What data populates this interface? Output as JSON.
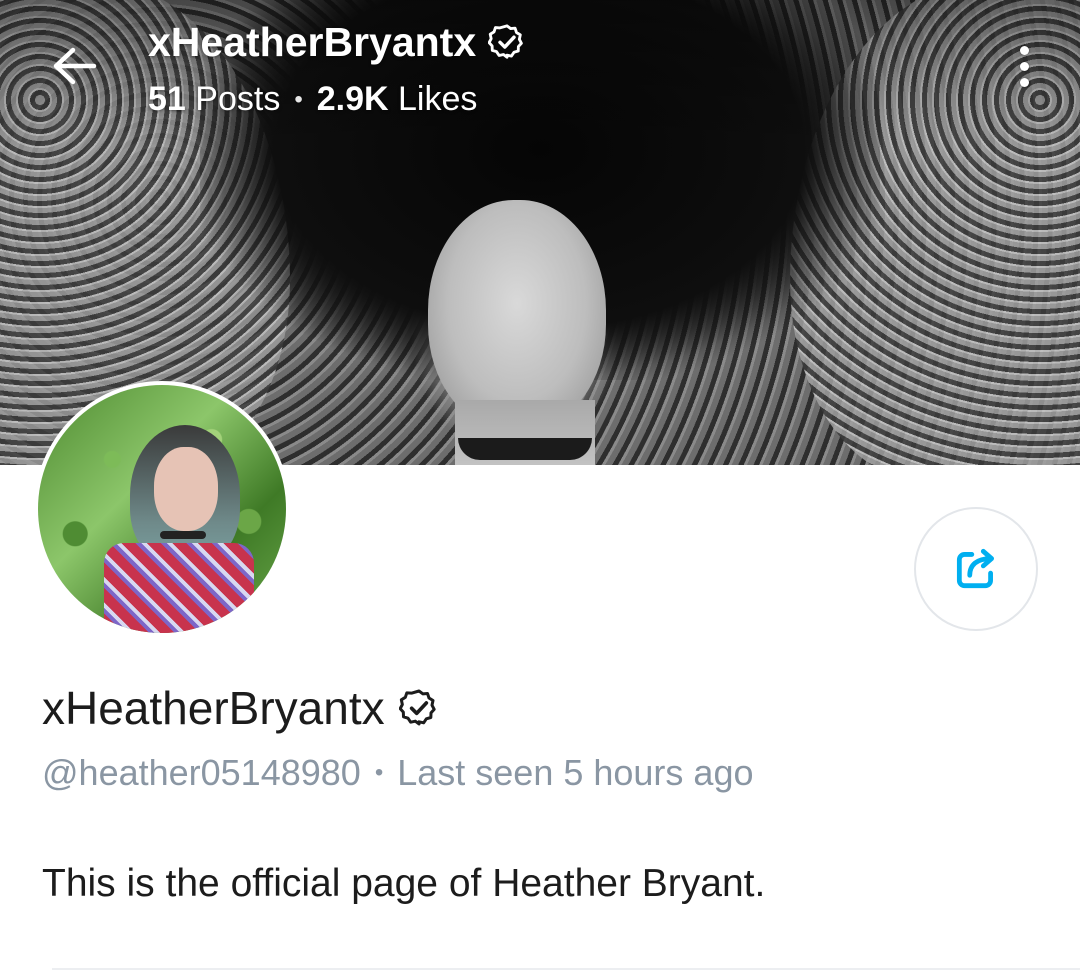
{
  "header": {
    "display_name": "xHeatherBryantx",
    "posts_count": "51",
    "posts_label": "Posts",
    "likes_count": "2.9K",
    "likes_label": "Likes",
    "separator": "•"
  },
  "icons": {
    "back": "back-arrow-icon",
    "verified": "verified-badge-icon",
    "menu": "more-vertical-icon",
    "share": "share-icon"
  },
  "profile": {
    "display_name": "xHeatherBryantx",
    "username": "@heather05148980",
    "separator": "•",
    "last_seen": "Last seen 5 hours ago",
    "bio": "This is the official page of Heather Bryant."
  },
  "colors": {
    "accent": "#00aff0",
    "muted_text": "#8a96a3",
    "primary_text": "#1c1c1c"
  }
}
